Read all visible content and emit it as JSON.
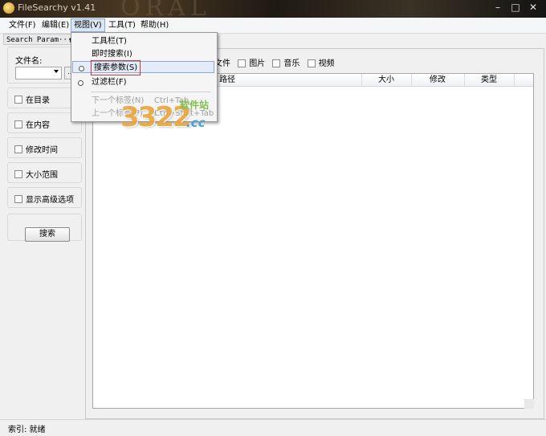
{
  "window": {
    "title": "FileSearchy v1.41",
    "bg_letters": "ORAL",
    "minimize": "–",
    "maximize": "□",
    "close": "✕"
  },
  "menubar": {
    "items": [
      "文件(F)",
      "编辑(E)",
      "视图(V)",
      "工具(T)",
      "帮助(H)"
    ],
    "active": "视图(V)"
  },
  "panel": {
    "header": "Search Param···",
    "pin": "🗗"
  },
  "left": {
    "filename_label": "文件名:",
    "filename_value": "",
    "browse_label": "...",
    "options": [
      "在目录",
      "在内容",
      "修改时间",
      "大小范围",
      "显示高级选项"
    ],
    "search_button": "搜索"
  },
  "filters": [
    "文件",
    "图片",
    "音乐",
    "视频"
  ],
  "columns": [
    "路径",
    "大小",
    "修改",
    "类型"
  ],
  "view_menu": {
    "items": [
      {
        "label": "工具栏(T)",
        "shortcut": "",
        "dot": false,
        "highlight": false,
        "disabled": false
      },
      {
        "label": "即时搜索(I)",
        "shortcut": "",
        "dot": false,
        "highlight": false,
        "disabled": false
      },
      {
        "label": "搜索参数(S)",
        "shortcut": "",
        "dot": true,
        "highlight": true,
        "disabled": false
      },
      {
        "label": "过滤栏(F)",
        "shortcut": "",
        "dot": true,
        "highlight": false,
        "disabled": false
      },
      {
        "label": "下一个标签(N)",
        "shortcut": "Ctrl+Tab",
        "dot": false,
        "highlight": false,
        "disabled": true
      },
      {
        "label": "上一个标签(P)",
        "shortcut": "Ctrl+Shift+Tab",
        "dot": false,
        "highlight": false,
        "disabled": true
      }
    ]
  },
  "watermark": {
    "number": "3322",
    "cn": "软件站",
    "domain": ".cc"
  },
  "status": {
    "text": "索引: 就绪"
  }
}
